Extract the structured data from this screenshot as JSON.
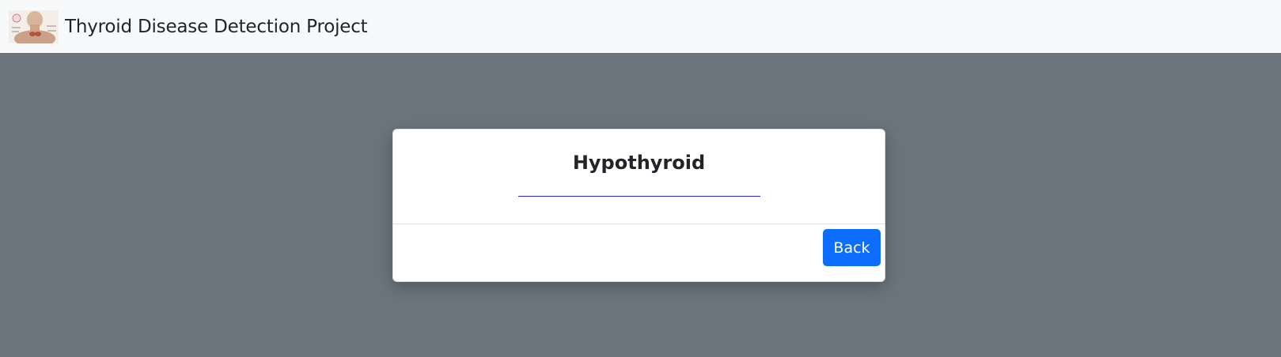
{
  "navbar": {
    "logo_icon": "thyroid-anatomy-illustration",
    "title": "Thyroid Disease Detection Project"
  },
  "result_modal": {
    "title": "Hypothyroid",
    "rule_color": "#2a2ae8",
    "back_label": "Back"
  },
  "colors": {
    "navbar_bg": "#f8f9fa",
    "backdrop": "#6c757d",
    "primary": "#0d6efd",
    "text": "#212529"
  }
}
